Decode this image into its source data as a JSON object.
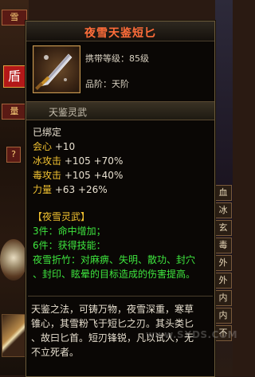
{
  "game": {
    "left_tabs": [
      "雪",
      "量"
    ],
    "left_emblem": "盾",
    "left_small_buttons": [
      "?"
    ],
    "right_tabs": [
      "血",
      "冰",
      "玄",
      "毒",
      "外",
      "外",
      "内",
      "内",
      "不"
    ]
  },
  "tooltip": {
    "title": "夜雪天鉴短匕",
    "item_icon": "dagger-icon",
    "level_text": "携带等级：85级",
    "grade_text": "品阶：天阶",
    "section_title": "天鉴灵武",
    "bound": "已绑定",
    "stats": [
      {
        "label": "会心",
        "value": "+10"
      },
      {
        "label": "冰攻击",
        "value": "+105 +70%"
      },
      {
        "label": "毒攻击",
        "value": "+105 +40%"
      },
      {
        "label": "力量",
        "value": "+63 +26%"
      }
    ],
    "set_title": "【夜雪灵武】",
    "set_3": "3件：命中增加；",
    "set_6": "6件：获得技能：",
    "skill_line1": "夜雪折竹：对麻痹、失明、散功、封穴",
    "skill_line2": "、封印、眩晕的目标造成的伤害提高。",
    "desc_line1": "天鉴之法，可铸万物，夜雪深重，寒草",
    "desc_line2": "锥心，其雪粉飞于短匕之刃。其头类匕",
    "desc_line3": "、故曰匕首。短刃锋锐，凡以试人，无",
    "desc_line4": "不立死者。"
  },
  "watermark": "www.SXDS.COM",
  "colors": {
    "title": "#ff6d3a",
    "stat_label": "#f0c030",
    "set_text": "#3ee63e",
    "text": "#e8e0d0"
  }
}
